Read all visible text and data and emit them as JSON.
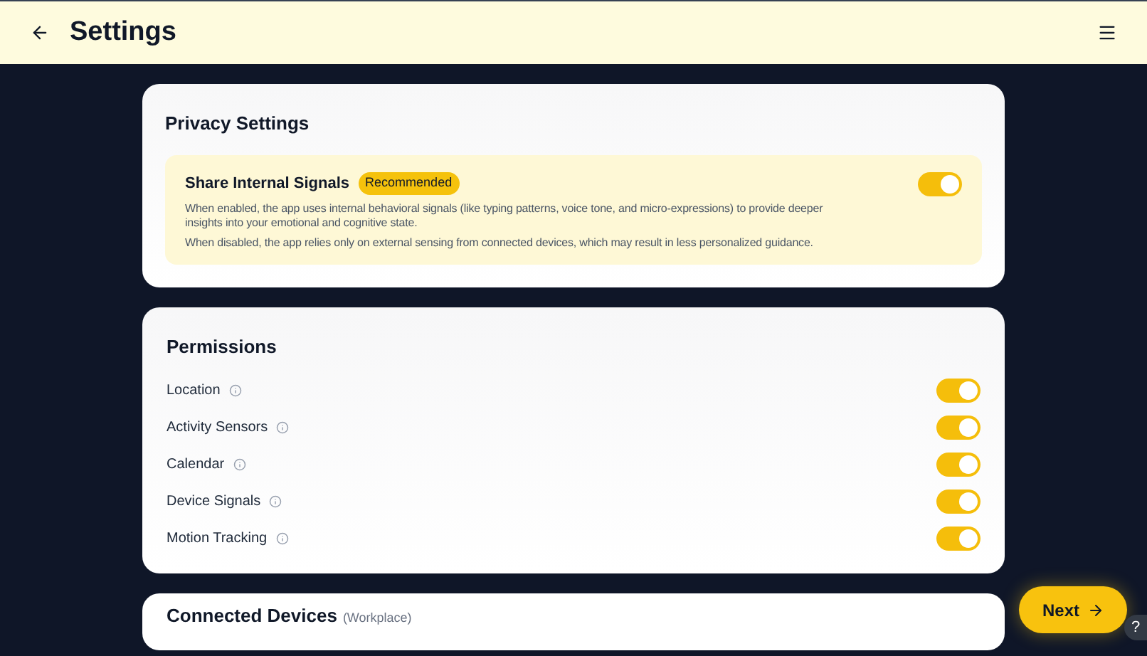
{
  "header": {
    "title": "Settings"
  },
  "privacy": {
    "title": "Privacy Settings",
    "setting": {
      "label": "Share Internal Signals",
      "badge": "Recommended",
      "on": true,
      "descriptions": [
        "When enabled, the app uses internal behavioral signals (like typing patterns, voice tone, and micro-expressions) to provide deeper insights into your emotional and cognitive state.",
        "When disabled, the app relies only on external sensing from connected devices, which may result in less personalized guidance."
      ]
    }
  },
  "permissions": {
    "title": "Permissions",
    "items": [
      {
        "label": "Location",
        "on": true
      },
      {
        "label": "Activity Sensors",
        "on": true
      },
      {
        "label": "Calendar",
        "on": true
      },
      {
        "label": "Device Signals",
        "on": true
      },
      {
        "label": "Motion Tracking",
        "on": true
      }
    ]
  },
  "connected_devices": {
    "title": "Connected Devices",
    "subtitle": "(Workplace)"
  },
  "next_button": "Next",
  "help_button": "?"
}
